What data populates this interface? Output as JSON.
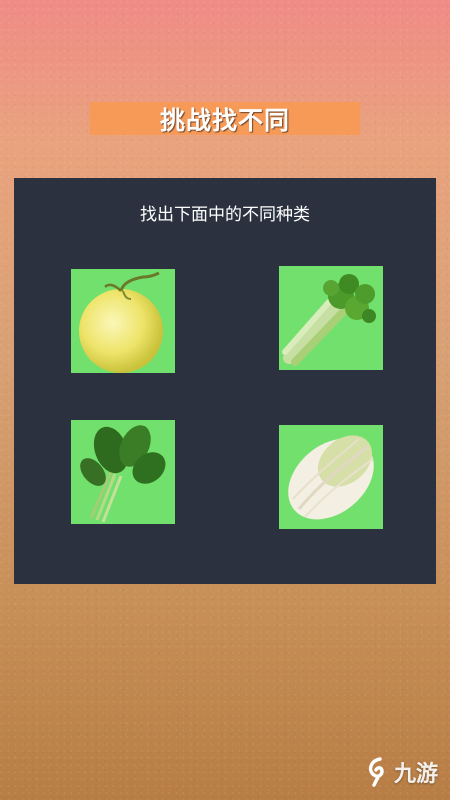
{
  "header": {
    "title": "挑战找不同"
  },
  "puzzle": {
    "instruction": "找出下面中的不同种类",
    "options": [
      {
        "id": "melon",
        "icon": "melon-icon"
      },
      {
        "id": "celery",
        "icon": "celery-icon"
      },
      {
        "id": "spinach",
        "icon": "spinach-icon"
      },
      {
        "id": "napa-cabbage",
        "icon": "napa-cabbage-icon"
      }
    ]
  },
  "watermark": {
    "text": "九游"
  },
  "colors": {
    "banner": "#f79a58",
    "panel": "#2b313f",
    "card": "#72e06d"
  }
}
